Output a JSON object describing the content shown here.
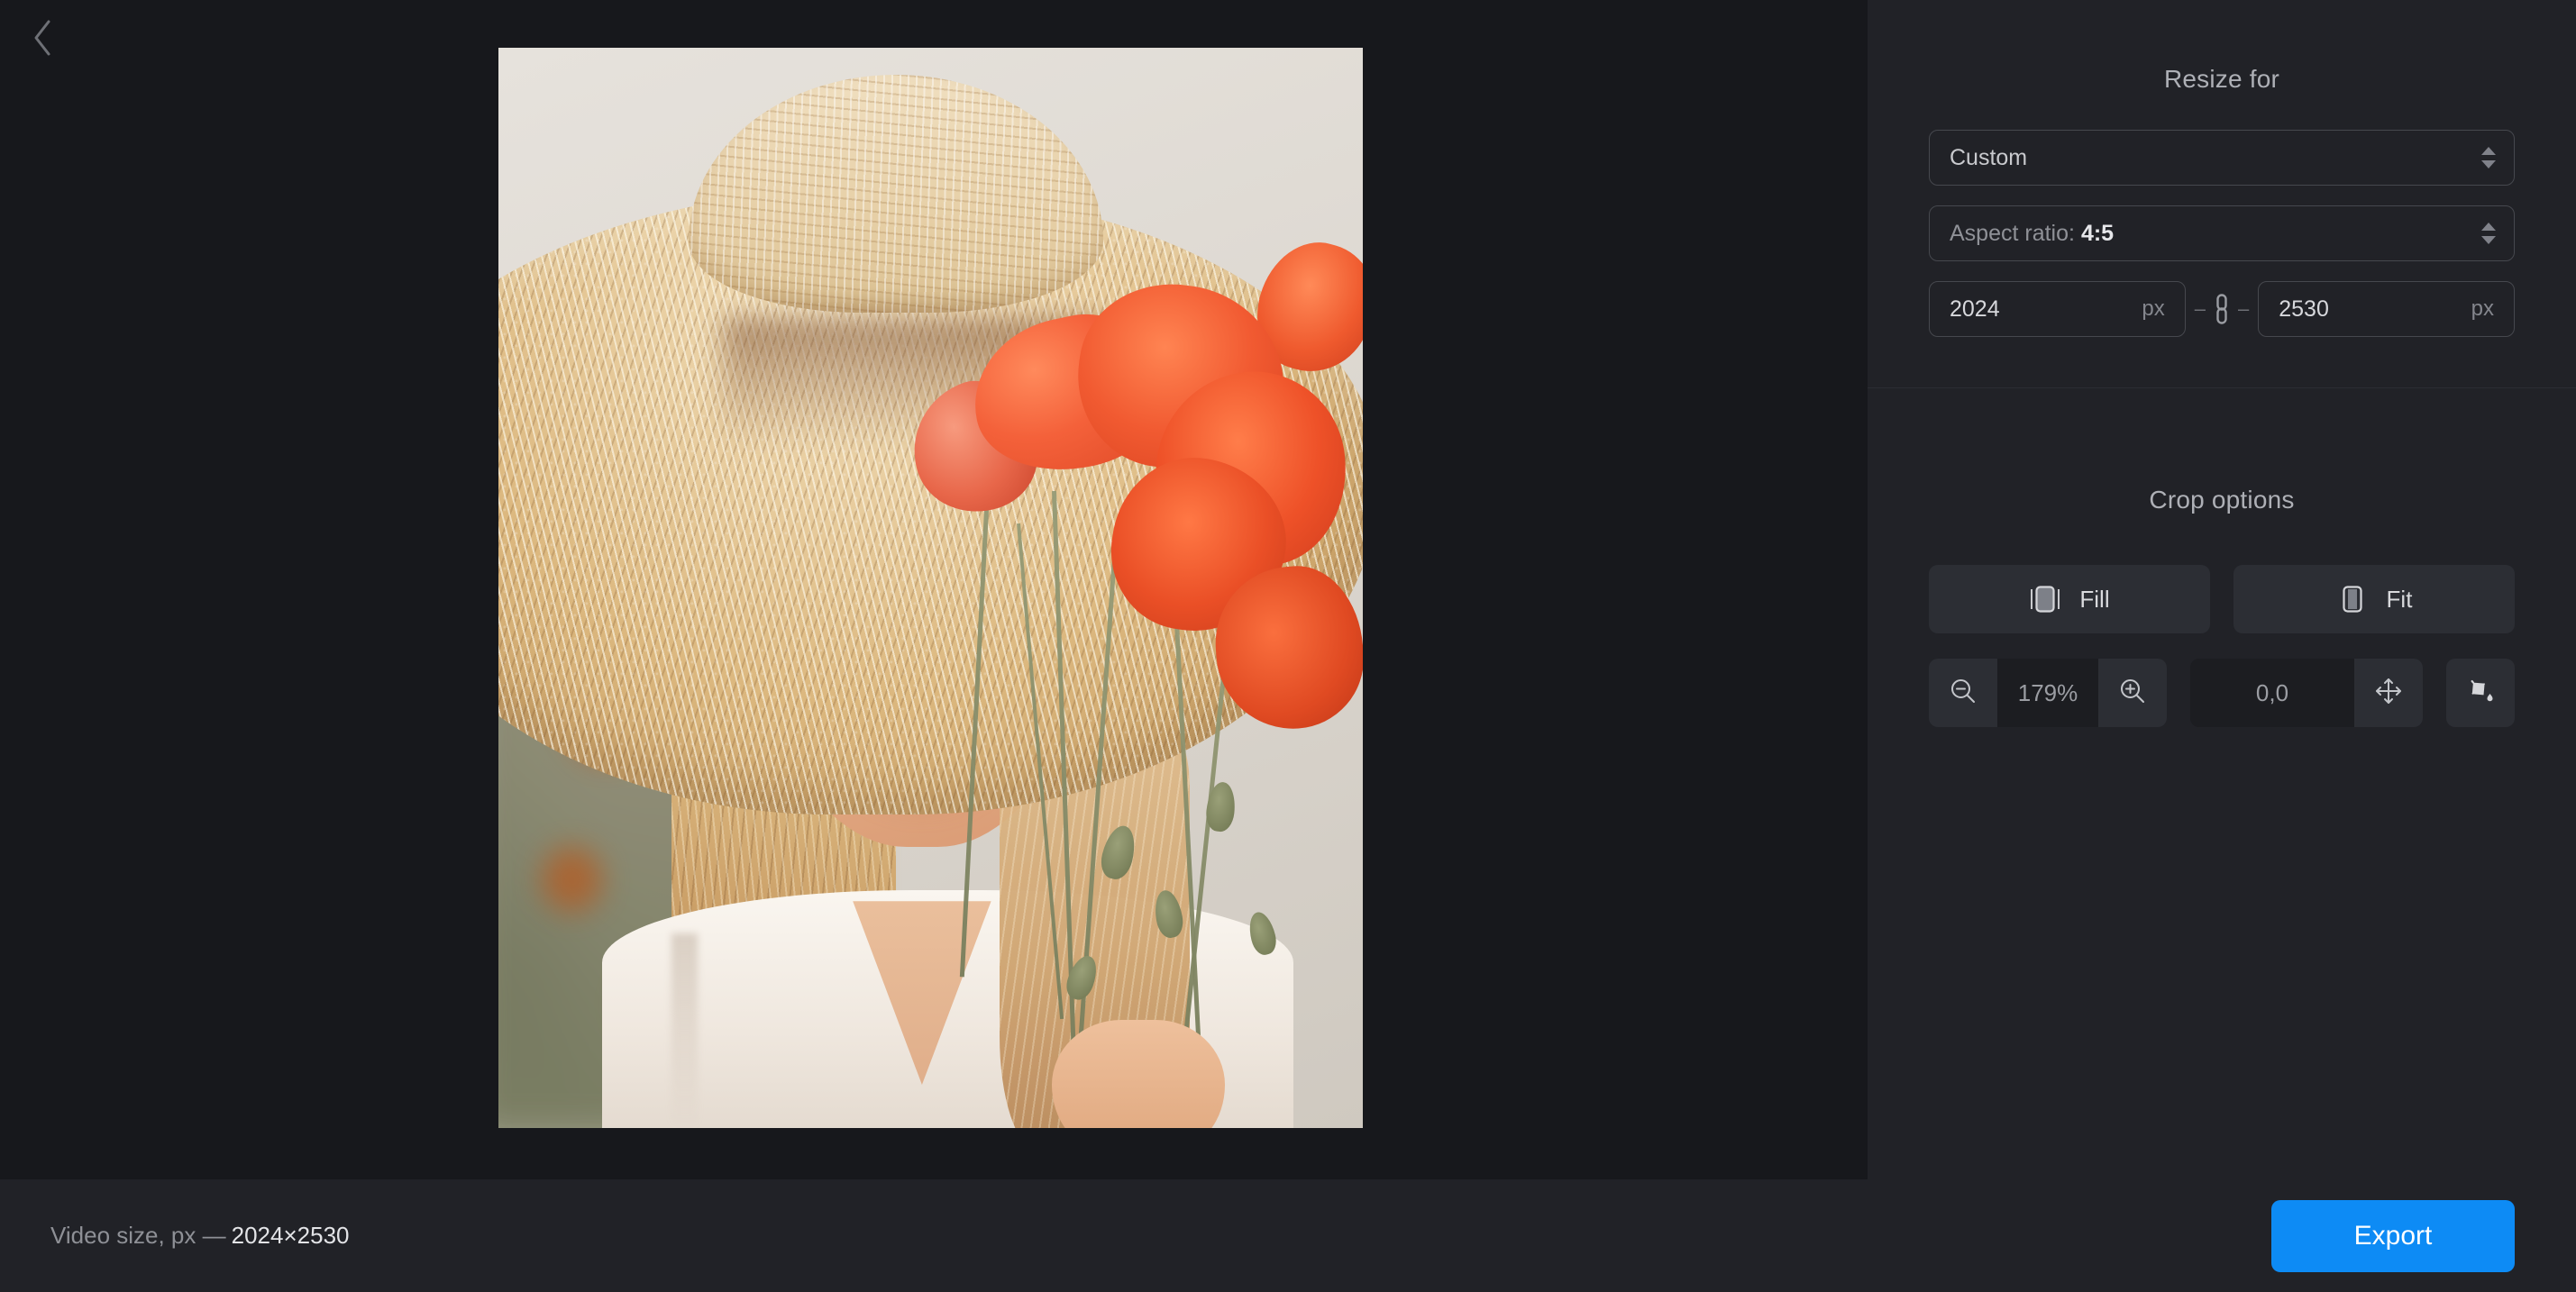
{
  "nav": {
    "back_icon": "chevron-left-icon"
  },
  "resize_panel": {
    "title": "Resize for",
    "preset": {
      "value": "Custom",
      "stepper_icon": "stepper-arrows-icon"
    },
    "aspect_ratio": {
      "label": "Aspect ratio:",
      "value": "4:5",
      "stepper_icon": "stepper-arrows-icon"
    },
    "width": {
      "value": "2024",
      "unit": "px"
    },
    "height": {
      "value": "2530",
      "unit": "px"
    },
    "link_icon": "link-chain-icon",
    "dash": "–"
  },
  "crop_panel": {
    "title": "Crop options",
    "fill_button": {
      "label": "Fill",
      "icon": "fill-crop-icon"
    },
    "fit_button": {
      "label": "Fit",
      "icon": "fit-crop-icon"
    },
    "zoom_out_icon": "zoom-out-icon",
    "zoom_level": "179%",
    "zoom_in_icon": "zoom-in-icon",
    "position_value": "0,0",
    "move_icon": "move-arrows-icon",
    "background_fill_icon": "paint-bucket-icon"
  },
  "footer": {
    "size_label": "Video size, px —",
    "size_value": "2024×2530",
    "export_label": "Export"
  },
  "colors": {
    "accent": "#0d8bf5",
    "panel_bg": "#212227",
    "canvas_bg": "#17181c",
    "control_bg": "#2c2e34",
    "field_bg": "#1c1d21",
    "text_primary": "#e3e4e7",
    "text_muted": "#8e9096"
  }
}
